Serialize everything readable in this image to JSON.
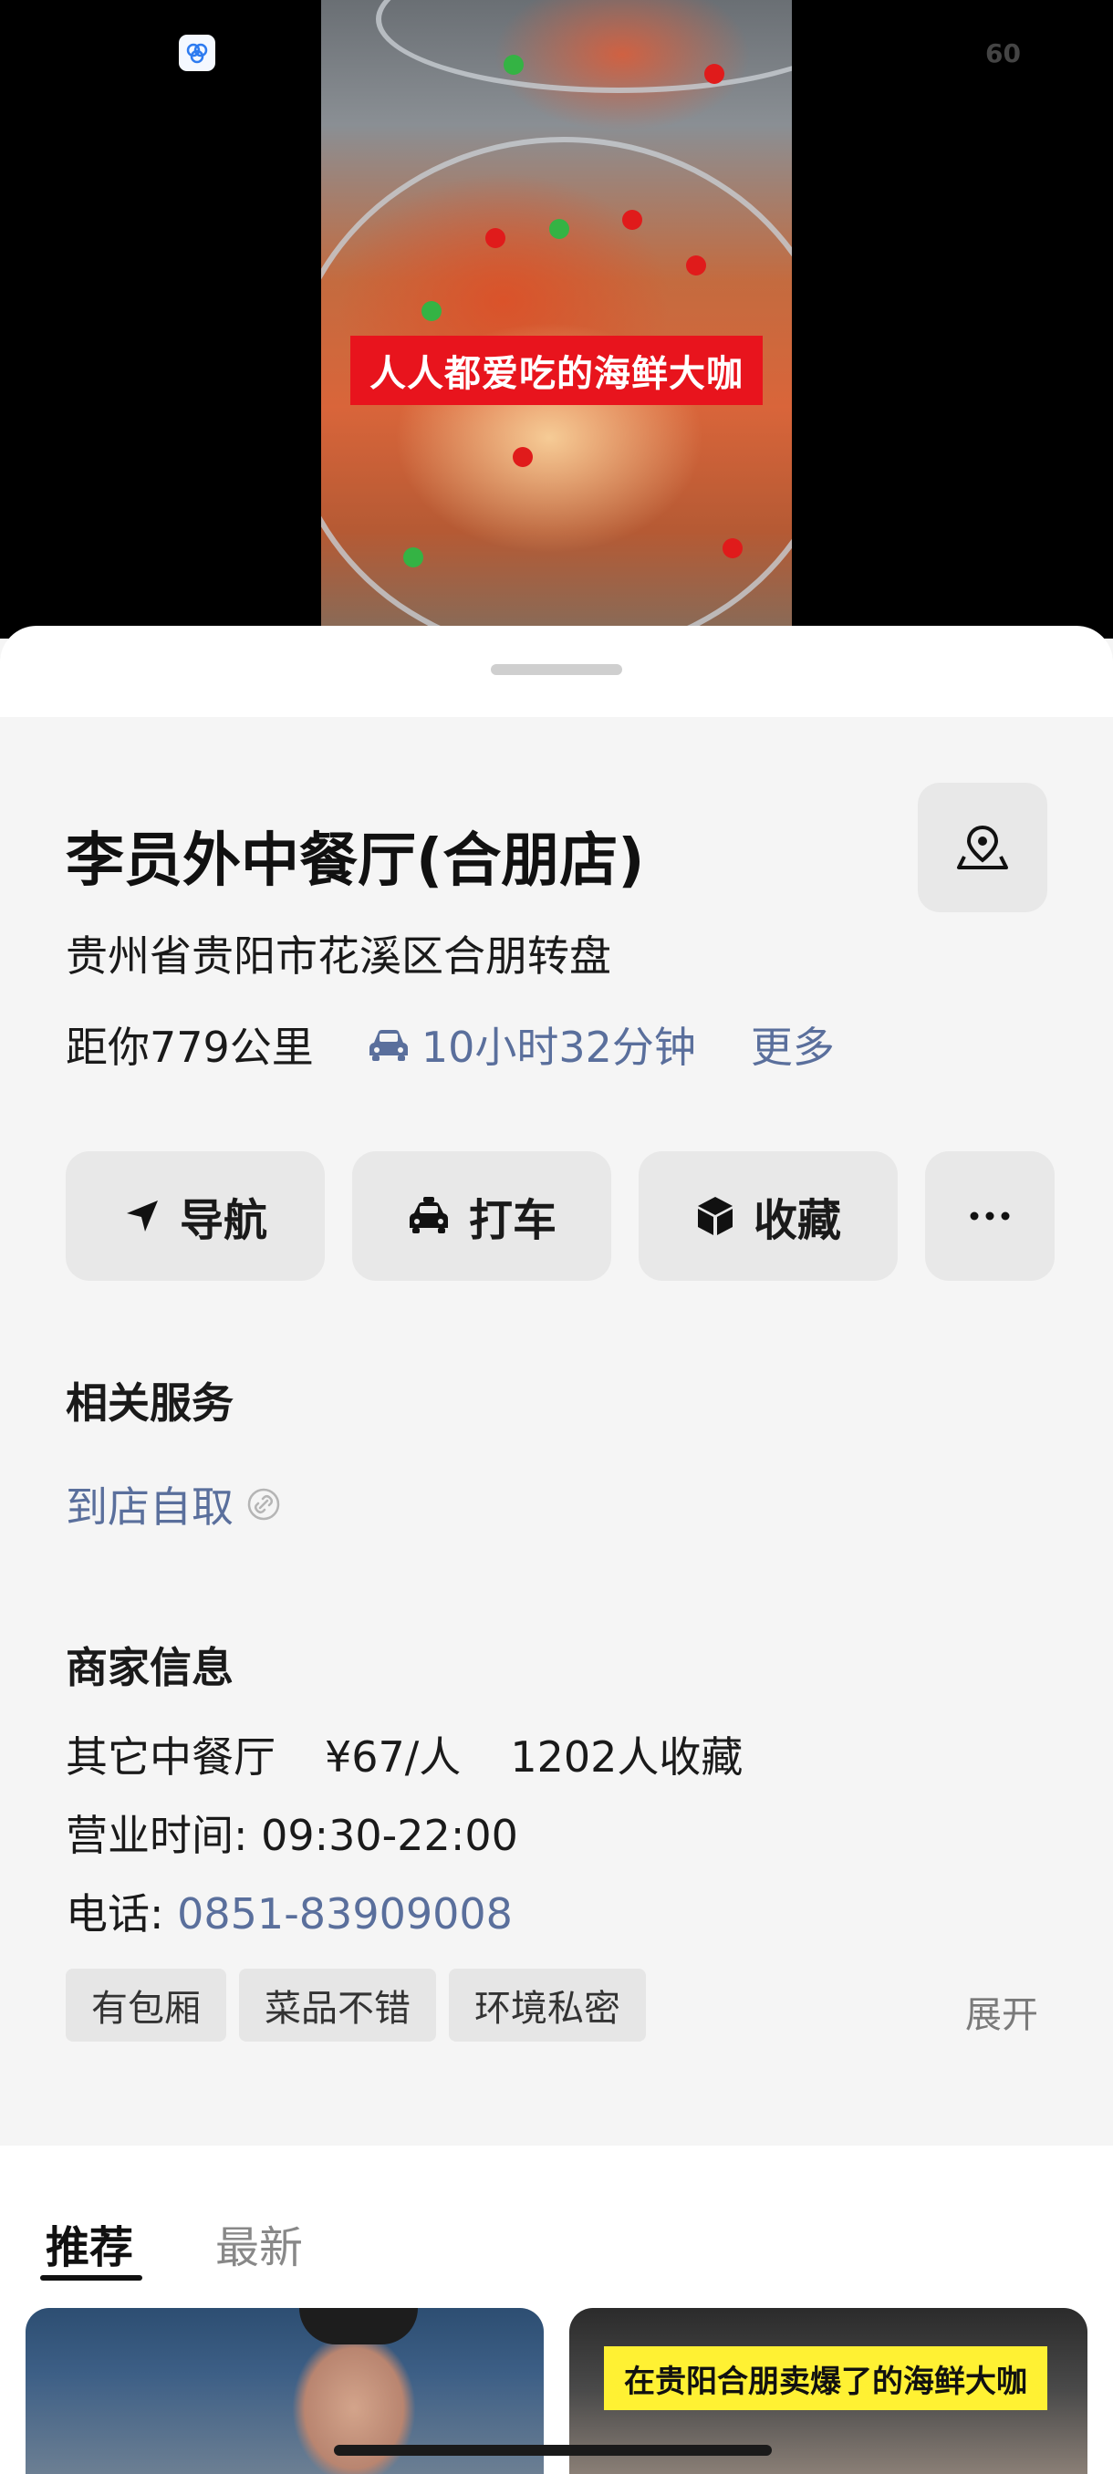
{
  "status": {
    "fps": "60"
  },
  "video": {
    "caption": "人人都爱吃的海鲜大咖"
  },
  "place": {
    "name": "李员外中餐厅(合朋店)",
    "address": "贵州省贵阳市花溪区合朋转盘",
    "distance": "距你779公里",
    "drive_time": "10小时32分钟",
    "more_label": "更多"
  },
  "actions": {
    "navigate": "导航",
    "taxi": "打车",
    "favorite": "收藏"
  },
  "services": {
    "heading": "相关服务",
    "items": [
      "到店自取"
    ]
  },
  "merchant": {
    "heading": "商家信息",
    "category": "其它中餐厅",
    "price": "¥67/人",
    "favorites": "1202人收藏",
    "hours": "营业时间: 09:30-22:00",
    "phone_label": "电话: ",
    "phone": "0851-83909008",
    "tags": [
      "有包厢",
      "菜品不错",
      "环境私密"
    ],
    "expand_label": "展开"
  },
  "feed": {
    "tabs": [
      "推荐",
      "最新"
    ],
    "active_tab": "推荐",
    "cards": [
      {
        "caption": ""
      },
      {
        "caption": "在贵阳合朋卖爆了的海鲜大咖"
      }
    ]
  },
  "colors": {
    "link": "#5a6f9c",
    "caption_bg": "#e8141d",
    "tag_bg": "#e6e6e6",
    "button_bg": "#e8e8e8",
    "page_bg": "#f5f5f5"
  },
  "icons": {
    "map_pin": "map-pin-icon",
    "car": "car-icon",
    "navigate": "navigation-arrow-icon",
    "taxi": "taxi-icon",
    "favorite": "cube-icon",
    "more": "more-dots-icon",
    "link": "link-icon"
  }
}
